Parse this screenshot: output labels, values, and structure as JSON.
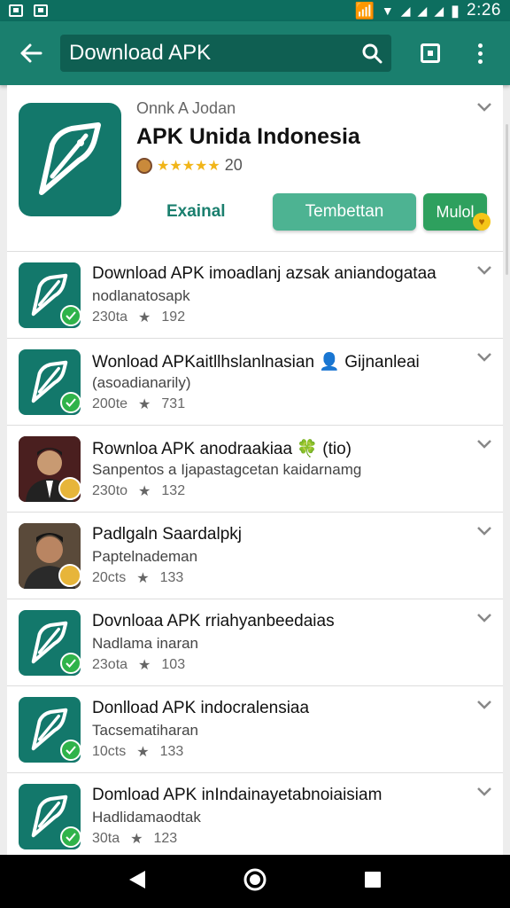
{
  "status_bar": {
    "time": "2:26"
  },
  "app_bar": {
    "search_value": "Download APK"
  },
  "header_card": {
    "developer": "Onnk A Jodan",
    "title": "APK Unida Indonesia",
    "rating_count": "20",
    "external_label": "Exainal",
    "primary_button": "Tembettan",
    "secondary_button": "Mulol"
  },
  "list": [
    {
      "title": "Download APK imoadlanj azsak aniandogataa",
      "subtitle": "nodlanatosapk",
      "size": "230ta",
      "rating": "192",
      "icon": "app-logo-icon"
    },
    {
      "title": "Wonload APKaitllhslanlnasian 👤 Gijnanleai",
      "subtitle": "(asoadianarily)",
      "size": "200te",
      "rating": "731",
      "icon": "app-logo-icon"
    },
    {
      "title": "Rownloa APK anodraakiaa 🍀 (tio)",
      "subtitle": "Sanpentos a Ijapastagcetan kaidarnamg",
      "size": "230to",
      "rating": "132",
      "icon": "person-photo"
    },
    {
      "title": "Padlgaln Saardalpkj",
      "subtitle": "Paptelnademan",
      "size": "20cts",
      "rating": "133",
      "icon": "person-photo"
    },
    {
      "title": "Dovnloaa APK rriahyanbeedaias",
      "subtitle": "Nadlama inaran",
      "size": "23ota",
      "rating": "103",
      "icon": "app-logo-icon"
    },
    {
      "title": "Donlload APK indocralensiaa",
      "subtitle": "Tacsematiharan",
      "size": "10cts",
      "rating": "133",
      "icon": "app-logo-icon"
    },
    {
      "title": "Domload APK inIndainayetabnoiaisiam",
      "subtitle": "Hadlidamaodtak",
      "size": "30ta",
      "rating": "123",
      "icon": "app-logo-icon"
    }
  ],
  "colors": {
    "appbar": "#1a7f6e",
    "statusbar": "#0d6e5f",
    "accent": "#4db392",
    "icon_bg": "#13786b"
  }
}
